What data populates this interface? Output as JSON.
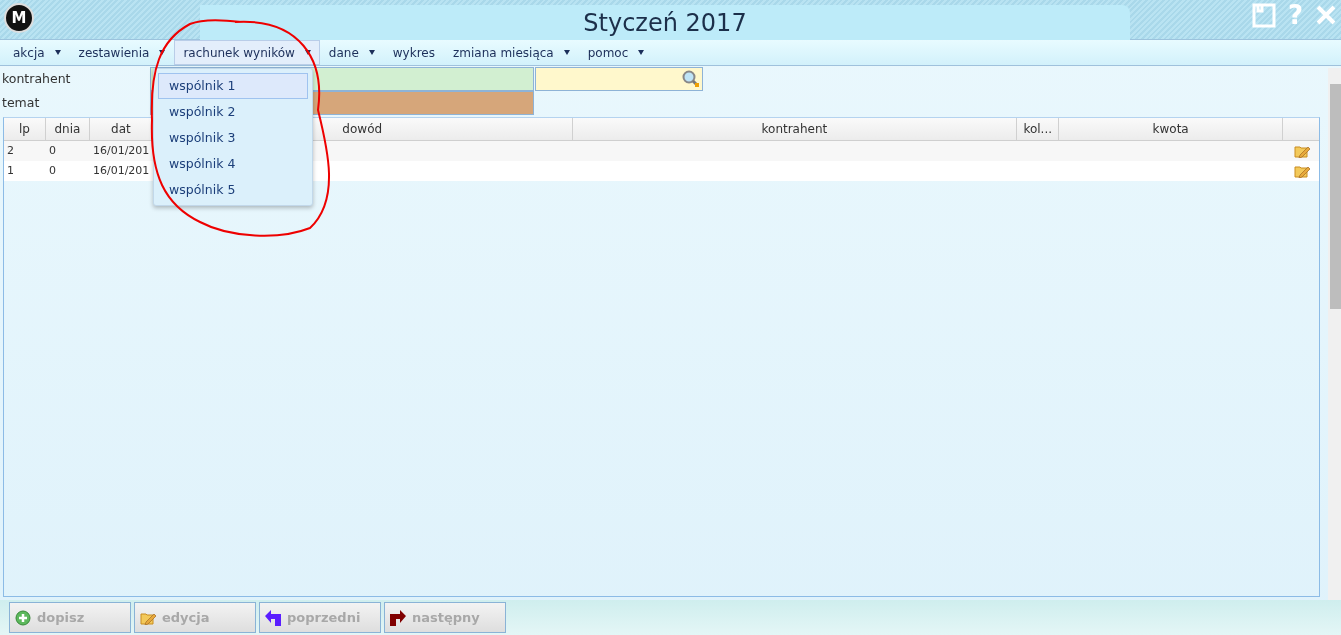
{
  "window": {
    "logo": "M",
    "title": "Styczeń 2017",
    "help": "?"
  },
  "menu": [
    {
      "label": "akcja",
      "dropdown": true,
      "open": false
    },
    {
      "label": "zestawienia",
      "dropdown": true,
      "open": false
    },
    {
      "label": "rachunek wyników",
      "dropdown": true,
      "open": true
    },
    {
      "label": "dane",
      "dropdown": true,
      "open": false
    },
    {
      "label": "wykres",
      "dropdown": false,
      "open": false
    },
    {
      "label": "zmiana miesiąca",
      "dropdown": true,
      "open": false
    },
    {
      "label": "pomoc",
      "dropdown": true,
      "open": false
    }
  ],
  "dropdown_items": [
    {
      "label": "wspólnik 1",
      "selected": true
    },
    {
      "label": "wspólnik 2",
      "selected": false
    },
    {
      "label": "wspólnik 3",
      "selected": false
    },
    {
      "label": "wspólnik 4",
      "selected": false
    },
    {
      "label": "wspólnik 5",
      "selected": false
    }
  ],
  "filters": [
    {
      "label": "kontrahent"
    },
    {
      "label": "temat"
    }
  ],
  "table": {
    "columns": [
      "lp",
      "dnia",
      "dat",
      "dowód",
      "kontrahent",
      "kol...",
      "kwota"
    ],
    "rows": [
      {
        "cells": [
          "2",
          "0",
          "16/01/201",
          "",
          "",
          "",
          ""
        ]
      },
      {
        "cells": [
          "1",
          "0",
          "16/01/201",
          "",
          "",
          "",
          ""
        ]
      }
    ]
  },
  "buttons": [
    {
      "label": "dopisz",
      "kind": "add",
      "disabled": true
    },
    {
      "label": "edycja",
      "kind": "edit",
      "disabled": true
    },
    {
      "label": "poprzedni",
      "kind": "prev",
      "disabled": true
    },
    {
      "label": "następny",
      "kind": "next",
      "disabled": true
    }
  ]
}
